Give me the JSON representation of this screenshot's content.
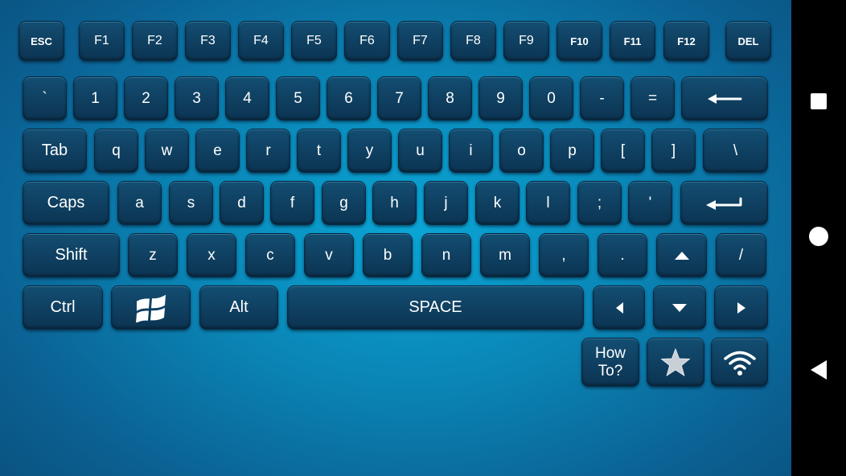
{
  "function_row": [
    "ESC",
    "F1",
    "F2",
    "F3",
    "F4",
    "F5",
    "F6",
    "F7",
    "F8",
    "F9",
    "F10",
    "F11",
    "F12",
    "DEL"
  ],
  "number_row": [
    "`",
    "1",
    "2",
    "3",
    "4",
    "5",
    "6",
    "7",
    "8",
    "9",
    "0",
    "-",
    "="
  ],
  "qwerty_row": [
    "Tab",
    "q",
    "w",
    "e",
    "r",
    "t",
    "y",
    "u",
    "i",
    "o",
    "p",
    "[",
    "]",
    "\\"
  ],
  "home_row": [
    "Caps",
    "a",
    "s",
    "d",
    "f",
    "g",
    "h",
    "j",
    "k",
    "l",
    ";",
    "'"
  ],
  "shift_row": [
    "Shift",
    "z",
    "x",
    "c",
    "v",
    "b",
    "n",
    "m",
    ",",
    "."
  ],
  "shift_row_extra": "/",
  "bottom_row": {
    "ctrl": "Ctrl",
    "alt": "Alt",
    "space": "SPACE"
  },
  "extras": {
    "how_to": "How\nTo?"
  },
  "icons": {
    "backspace": "left-arrow-icon",
    "enter": "enter-icon",
    "windows": "windows-logo-icon",
    "up": "arrow-up-icon",
    "left": "arrow-left-icon",
    "down": "arrow-down-icon",
    "right": "arrow-right-icon",
    "favorite": "star-icon",
    "connection": "wifi-icon"
  },
  "system_nav": [
    "recents-square-icon",
    "home-circle-icon",
    "back-triangle-icon"
  ],
  "colors": {
    "background": "#0a86b6",
    "key": "#0f3f60",
    "key_text": "#ffffff",
    "nav_bar": "#000000"
  }
}
